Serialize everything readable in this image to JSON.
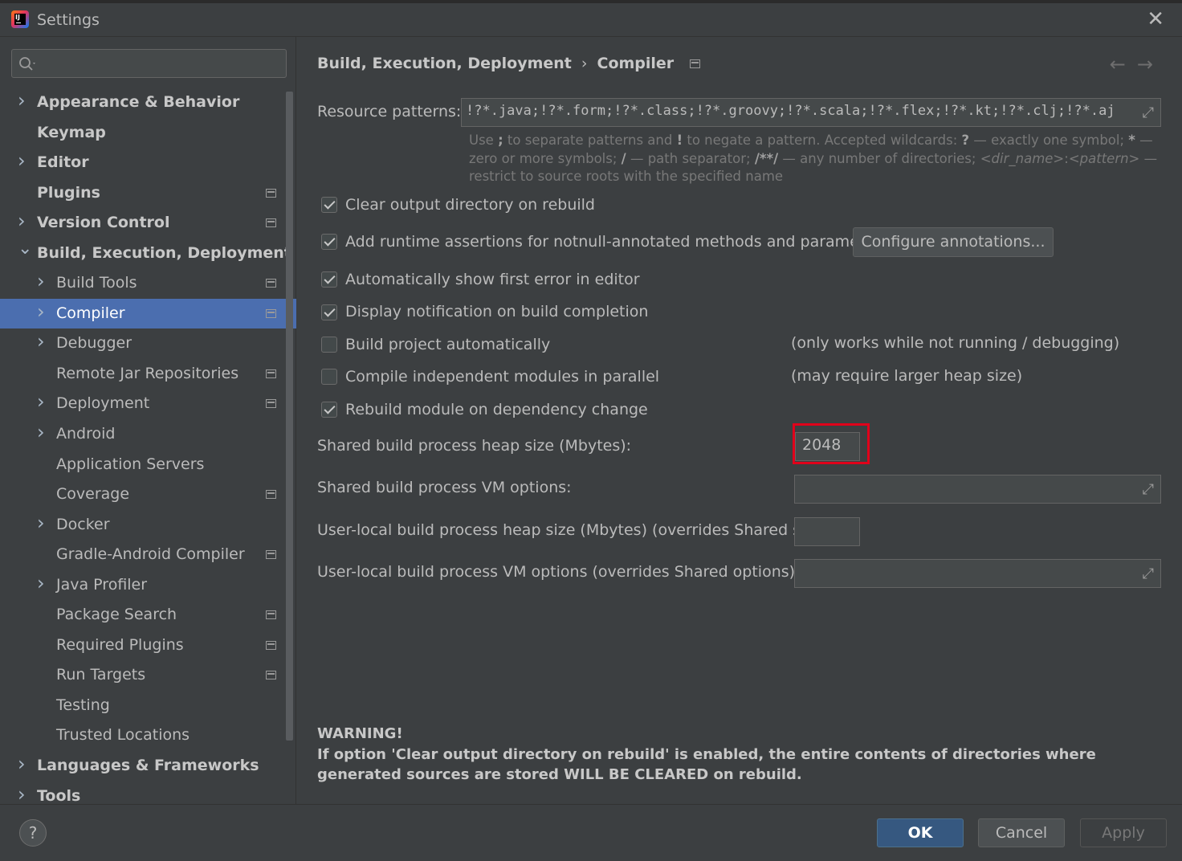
{
  "window": {
    "title": "Settings"
  },
  "search": {
    "placeholder": ""
  },
  "sidebar": {
    "items": [
      {
        "label": "Appearance & Behavior",
        "level": 0,
        "chevron": "right",
        "project": false
      },
      {
        "label": "Keymap",
        "level": 0,
        "chevron": "none",
        "project": false
      },
      {
        "label": "Editor",
        "level": 0,
        "chevron": "right",
        "project": false
      },
      {
        "label": "Plugins",
        "level": 0,
        "chevron": "none",
        "project": true
      },
      {
        "label": "Version Control",
        "level": 0,
        "chevron": "right",
        "project": true
      },
      {
        "label": "Build, Execution, Deployment",
        "level": 0,
        "chevron": "down",
        "project": false
      },
      {
        "label": "Build Tools",
        "level": 1,
        "chevron": "right",
        "project": true
      },
      {
        "label": "Compiler",
        "level": 1,
        "chevron": "right",
        "project": true,
        "selected": true
      },
      {
        "label": "Debugger",
        "level": 1,
        "chevron": "right",
        "project": false
      },
      {
        "label": "Remote Jar Repositories",
        "level": 1,
        "chevron": "none",
        "project": true
      },
      {
        "label": "Deployment",
        "level": 1,
        "chevron": "right",
        "project": true
      },
      {
        "label": "Android",
        "level": 1,
        "chevron": "right",
        "project": false
      },
      {
        "label": "Application Servers",
        "level": 1,
        "chevron": "none",
        "project": false
      },
      {
        "label": "Coverage",
        "level": 1,
        "chevron": "none",
        "project": true
      },
      {
        "label": "Docker",
        "level": 1,
        "chevron": "right",
        "project": false
      },
      {
        "label": "Gradle-Android Compiler",
        "level": 1,
        "chevron": "none",
        "project": true
      },
      {
        "label": "Java Profiler",
        "level": 1,
        "chevron": "right",
        "project": false
      },
      {
        "label": "Package Search",
        "level": 1,
        "chevron": "none",
        "project": true
      },
      {
        "label": "Required Plugins",
        "level": 1,
        "chevron": "none",
        "project": true
      },
      {
        "label": "Run Targets",
        "level": 1,
        "chevron": "none",
        "project": true
      },
      {
        "label": "Testing",
        "level": 1,
        "chevron": "none",
        "project": false
      },
      {
        "label": "Trusted Locations",
        "level": 1,
        "chevron": "none",
        "project": false
      },
      {
        "label": "Languages & Frameworks",
        "level": 0,
        "chevron": "right",
        "project": false
      },
      {
        "label": "Tools",
        "level": 0,
        "chevron": "right",
        "project": false
      }
    ]
  },
  "breadcrumb": {
    "parent": "Build, Execution, Deployment",
    "separator": "›",
    "current": "Compiler"
  },
  "nav": {
    "back": "←",
    "forward": "→"
  },
  "resource": {
    "label": "Resource patterns:",
    "value": "!?*.java;!?*.form;!?*.class;!?*.groovy;!?*.scala;!?*.flex;!?*.kt;!?*.clj;!?*.aj",
    "hint": {
      "p1": "Use ",
      "b1": ";",
      "p2": " to separate patterns and ",
      "b2": "!",
      "p3": " to negate a pattern. Accepted wildcards: ",
      "b3": "?",
      "p4": " — exactly one symbol; ",
      "b4": "*",
      "p5": " — zero or more symbols; ",
      "b5": "/",
      "p6": " — path separator; ",
      "b6": "/**/",
      "p7": " — any number of directories; ",
      "i1": "<dir_name>",
      "p8": ":",
      "i2": "<pattern>",
      "p9": " — restrict to source roots with the specified name"
    }
  },
  "options": {
    "clear_output": {
      "label": "Clear output directory on rebuild",
      "checked": true
    },
    "runtime_assertions": {
      "label": "Add runtime assertions for notnull-annotated methods and parameters",
      "checked": true
    },
    "configure_button": "Configure annotations...",
    "show_first_error": {
      "label": "Automatically show first error in editor",
      "checked": true
    },
    "notify_completion": {
      "label": "Display notification on build completion",
      "checked": true
    },
    "build_auto": {
      "label": "Build project automatically",
      "checked": false,
      "note": "(only works while not running / debugging)"
    },
    "parallel": {
      "label": "Compile independent modules in parallel",
      "checked": false,
      "note": "(may require larger heap size)"
    },
    "rebuild_dep": {
      "label": "Rebuild module on dependency change",
      "checked": true
    }
  },
  "heap": {
    "shared_heap_label": "Shared build process heap size (Mbytes):",
    "shared_heap_value": "2048",
    "shared_vm_label": "Shared build process VM options:",
    "shared_vm_value": "",
    "local_heap_label": "User-local build process heap size (Mbytes) (overrides Shared size):",
    "local_heap_value": "",
    "local_vm_label": "User-local build process VM options (overrides Shared options):",
    "local_vm_value": ""
  },
  "warning": {
    "title": "WARNING!",
    "text": "If option 'Clear output directory on rebuild' is enabled, the entire contents of directories where generated sources are stored WILL BE CLEARED on rebuild."
  },
  "footer": {
    "help": "?",
    "ok": "OK",
    "cancel": "Cancel",
    "apply": "Apply"
  },
  "colors": {
    "background": "#3c3f41",
    "selection": "#4b6eaf",
    "ok_button": "#365880",
    "highlight": "#e0001a"
  }
}
